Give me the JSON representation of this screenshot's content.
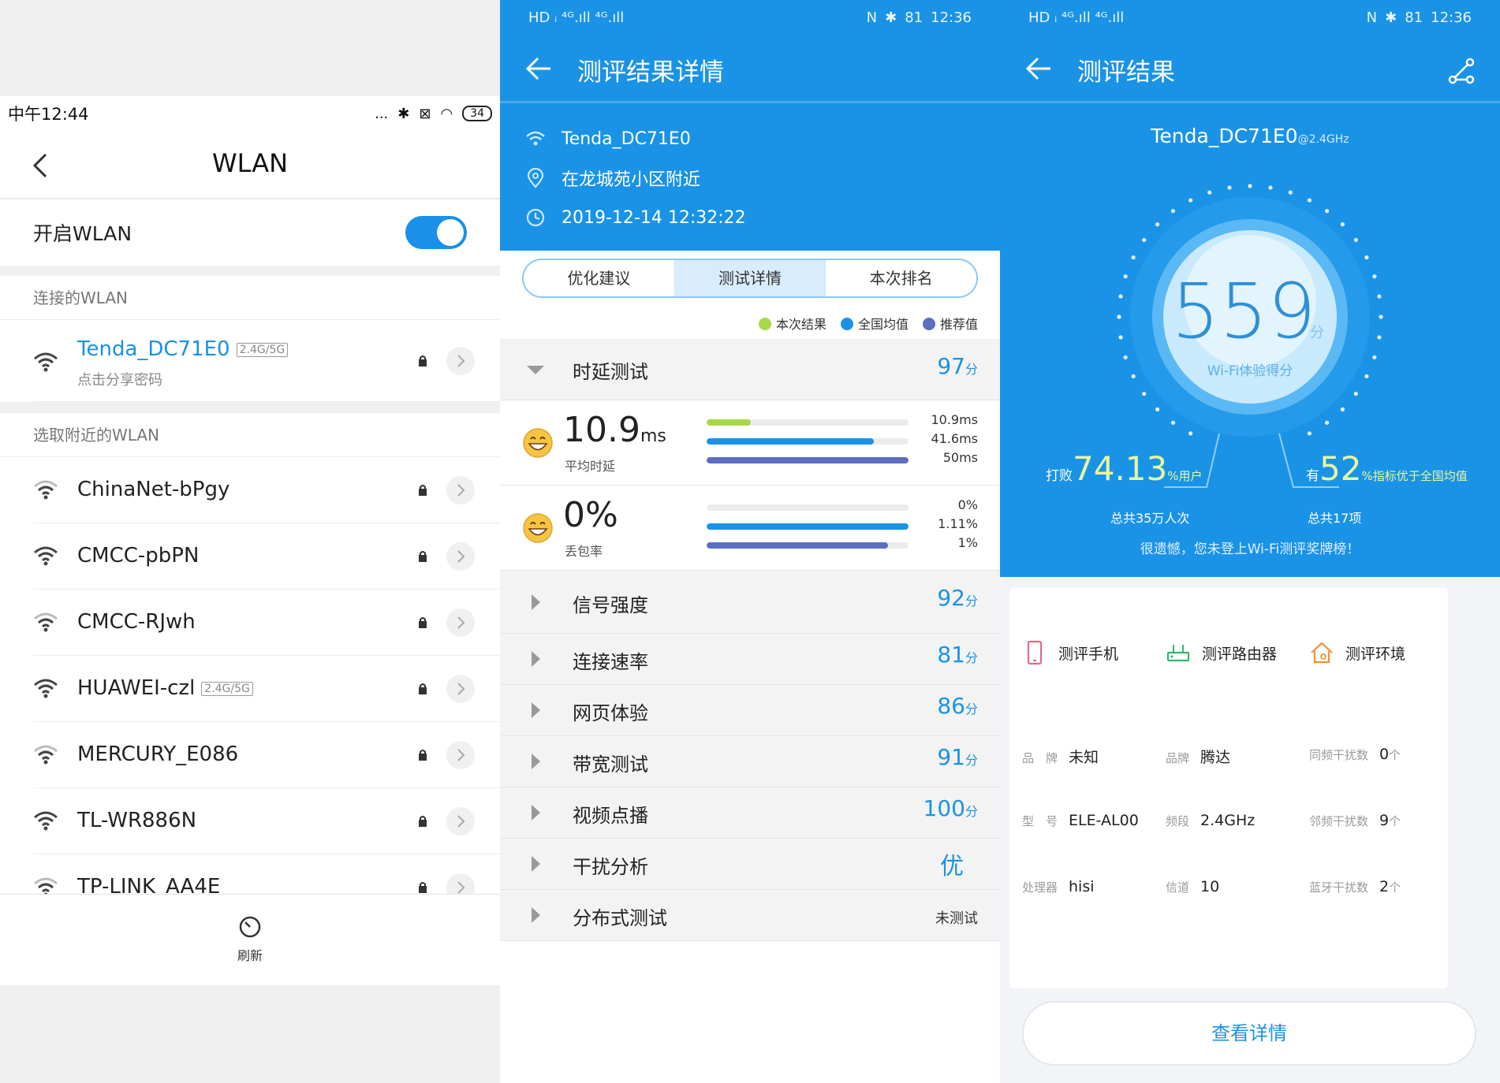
{
  "panel1": {
    "status": {
      "time": "中午12:44",
      "dots": "...",
      "battery": "34"
    },
    "title": "WLAN",
    "toggle_label": "开启WLAN",
    "toggle_on": true,
    "connected_label": "连接的WLAN",
    "connected": {
      "name": "Tenda_DC71E0",
      "badge": "2.4G/5G",
      "sub": "点击分享密码"
    },
    "nearby_label": "选取附近的WLAN",
    "networks": [
      {
        "name": "ChinaNet-bPgy",
        "badge": ""
      },
      {
        "name": "CMCC-pbPN",
        "badge": ""
      },
      {
        "name": "CMCC-RJwh",
        "badge": ""
      },
      {
        "name": "HUAWEI-czl",
        "badge": "2.4G/5G"
      },
      {
        "name": "MERCURY_E086",
        "badge": ""
      },
      {
        "name": "TL-WR886N",
        "badge": ""
      },
      {
        "name": "TP-LINK_AA4E",
        "badge": ""
      }
    ],
    "refresh_label": "刷新"
  },
  "panel2": {
    "status": {
      "left": "HD ᵢ ⁴ᴳ.ıll ⁴ᴳ.ıll",
      "battery": "81",
      "time": "12:36"
    },
    "title": "测评结果详情",
    "ssid": "Tenda_DC71E0",
    "location": "在龙城苑小区附近",
    "datetime": "2019-12-14 12:32:22",
    "tabs": [
      "优化建议",
      "测试详情",
      "本次排名"
    ],
    "active_tab": 1,
    "legend": [
      {
        "label": "本次结果",
        "color": "#a8d84a"
      },
      {
        "label": "全国均值",
        "color": "#1a93e6"
      },
      {
        "label": "推荐值",
        "color": "#5b6ec0"
      }
    ],
    "latency": {
      "label": "时延测试",
      "score": "97",
      "unit": "分",
      "value": "10.9",
      "value_unit": "ms",
      "caption": "平均时延",
      "bars": [
        {
          "text": "10.9ms",
          "fraction": 0.22,
          "color": "#a8d84a"
        },
        {
          "text": "41.6ms",
          "fraction": 0.83,
          "color": "#1a93e6"
        },
        {
          "text": "50ms",
          "fraction": 1.0,
          "color": "#5b6ec0"
        }
      ]
    },
    "loss": {
      "value": "0%",
      "caption": "丢包率",
      "bars": [
        {
          "text": "0%",
          "fraction": 0.0,
          "color": "#a8d84a"
        },
        {
          "text": "1.11%",
          "fraction": 1.0,
          "color": "#1a93e6"
        },
        {
          "text": "1%",
          "fraction": 0.9,
          "color": "#5b6ec0"
        }
      ]
    },
    "categories": [
      {
        "label": "信号强度",
        "score": "92",
        "unit": "分"
      },
      {
        "label": "连接速率",
        "score": "81",
        "unit": "分"
      },
      {
        "label": "网页体验",
        "score": "86",
        "unit": "分"
      },
      {
        "label": "带宽测试",
        "score": "91",
        "unit": "分"
      },
      {
        "label": "视频点播",
        "score": "100",
        "unit": "分"
      },
      {
        "label": "干扰分析",
        "score": "优",
        "unit": ""
      },
      {
        "label": "分布式测试",
        "score": "未测试",
        "unit": ""
      }
    ]
  },
  "panel3": {
    "status": {
      "battery": "81",
      "time": "12:36"
    },
    "title": "测评结果",
    "ssid": "Tenda_DC71E0",
    "band": "@2.4GHz",
    "score": "559",
    "score_unit": "分",
    "score_caption": "Wi-Fi体验得分",
    "beat_prefix": "打败",
    "beat_value": "74.13",
    "beat_suffix": "%用户",
    "beat_total": "总共35万人次",
    "better_prefix": "有",
    "better_value": "52",
    "better_suffix": "%指标优于全国均值",
    "better_total": "总共17项",
    "note": "很遗憾，您未登上Wi-Fi测评奖牌榜！",
    "cards": [
      {
        "title": "测评手机",
        "rows": [
          {
            "k": "品　牌",
            "v": "未知",
            "u": ""
          },
          {
            "k": "型　号",
            "v": "ELE-AL00",
            "u": ""
          },
          {
            "k": "处理器",
            "v": "hisi",
            "u": ""
          }
        ]
      },
      {
        "title": "测评路由器",
        "rows": [
          {
            "k": "品牌",
            "v": "腾达",
            "u": ""
          },
          {
            "k": "频段",
            "v": "2.4GHz",
            "u": ""
          },
          {
            "k": "信道",
            "v": "10",
            "u": ""
          }
        ]
      },
      {
        "title": "测评环境",
        "rows": [
          {
            "k": "同频干扰数",
            "v": "0",
            "u": "个"
          },
          {
            "k": "邻频干扰数",
            "v": "9",
            "u": "个"
          },
          {
            "k": "蓝牙干扰数",
            "v": "2",
            "u": "个"
          }
        ]
      }
    ],
    "detail_button": "查看详情"
  }
}
